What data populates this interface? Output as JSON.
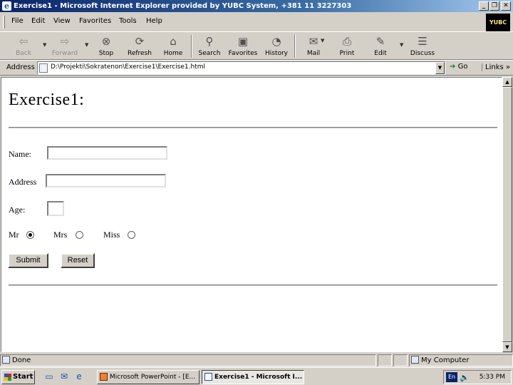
{
  "window": {
    "title": "Exercise1 - Microsoft Internet Explorer provided by YUBC System, +381 11 3227303",
    "controls": [
      "_",
      "❐",
      "✕"
    ]
  },
  "menu": [
    "File",
    "Edit",
    "View",
    "Favorites",
    "Tools",
    "Help"
  ],
  "brand_logo_text": "YUBC",
  "toolbar": {
    "back": "Back",
    "forward": "Forward",
    "stop": "Stop",
    "refresh": "Refresh",
    "home": "Home",
    "search": "Search",
    "favorites": "Favorites",
    "history": "History",
    "mail": "Mail",
    "print": "Print",
    "edit": "Edit",
    "discuss": "Discuss"
  },
  "address": {
    "label": "Address",
    "value": "D:\\Projekti\\Sokratenon\\Exercise1\\Exercise1.html",
    "go": "Go",
    "links": "Links"
  },
  "page": {
    "title": "Exercise1:",
    "name_label": "Name:",
    "name_value": "",
    "address_label": "Address",
    "address_value": "",
    "age_label": "Age:",
    "age_value": "",
    "radios": [
      {
        "label": "Mr",
        "checked": true
      },
      {
        "label": "Mrs",
        "checked": false
      },
      {
        "label": "Miss",
        "checked": false
      }
    ],
    "submit": "Submit",
    "reset": "Reset"
  },
  "status": {
    "text": "Done",
    "zone": "My Computer"
  },
  "taskbar": {
    "start": "Start",
    "tasks": [
      {
        "label": "Microsoft PowerPoint - [E...",
        "active": false
      },
      {
        "label": "Exercise1 - Microsoft I...",
        "active": true
      }
    ],
    "language": "En",
    "clock": "5:33 PM"
  }
}
